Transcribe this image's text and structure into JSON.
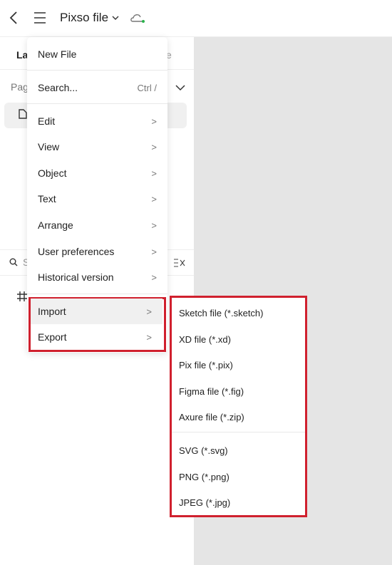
{
  "header": {
    "title": "Pixso file",
    "back_icon": "chevron-left-icon",
    "menu_icon": "hamburger-icon",
    "cloud_icon": "cloud-icon",
    "sync_color": "#2bb24c"
  },
  "sidebar": {
    "tab_partial": "La",
    "tab_right_partial": "e",
    "pages_partial": "Pag",
    "search_partial": "S"
  },
  "menu": {
    "items": [
      {
        "label": "New File"
      },
      {
        "label": "Search...",
        "shortcut": "Ctrl /"
      },
      {
        "label": "Edit"
      },
      {
        "label": "View"
      },
      {
        "label": "Object"
      },
      {
        "label": "Text"
      },
      {
        "label": "Arrange"
      },
      {
        "label": "User preferences"
      },
      {
        "label": "Historical version"
      },
      {
        "label": "Import"
      },
      {
        "label": "Export"
      }
    ]
  },
  "submenu": {
    "items": [
      "Sketch file (*.sketch)",
      "XD file (*.xd)",
      "Pix file (*.pix)",
      "Figma file (*.fig)",
      "Axure file (*.zip)",
      "SVG (*.svg)",
      "PNG (*.png)",
      "JPEG (*.jpg)"
    ]
  },
  "highlight_color": "#d0202e"
}
